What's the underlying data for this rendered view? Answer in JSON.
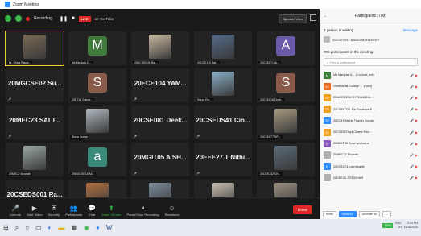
{
  "window": {
    "title": "Zoom Meeting"
  },
  "topbar": {
    "recording": "Recording...",
    "live_badge": "LIVE",
    "stream_target": "on YouTube",
    "speaker_view": "Speaker View"
  },
  "tiles": [
    {
      "kind": "photo",
      "label": "Dr. Shiva Rama...",
      "color": "#7a6a55",
      "active": true
    },
    {
      "kind": "initial",
      "initial": "M",
      "color": "#3f7b3a",
      "label": "Ms Manjula G..."
    },
    {
      "kind": "photo",
      "label": "20ECSED41 Raj...",
      "color": "#c9b9a0"
    },
    {
      "kind": "photo",
      "label": "20CSE119 Sat...",
      "color": "#556b8a"
    },
    {
      "kind": "initial",
      "initial": "A",
      "color": "#6b5aa8",
      "label": "20CSE071 Ar..."
    },
    {
      "kind": "name",
      "name": "20MGCSE02  Su...",
      "label": ""
    },
    {
      "kind": "initial",
      "initial": "S",
      "color": "#8a5a4a",
      "label": "20ET13 Sakrat..."
    },
    {
      "kind": "name",
      "name": "20ECE104  YAM...",
      "label": ""
    },
    {
      "kind": "photo",
      "label": "Surya Ra...",
      "color": "#8ab0c8"
    },
    {
      "kind": "initial",
      "initial": "S",
      "color": "#8a5a4a",
      "label": "20CSE016 Chall..."
    },
    {
      "kind": "name",
      "name": "20MEC23  SAI T...",
      "label": ""
    },
    {
      "kind": "photo",
      "label": "Shiva Kumar",
      "color": "#b0b8c0"
    },
    {
      "kind": "name",
      "name": "20CSE081  Deek...",
      "label": ""
    },
    {
      "kind": "name",
      "name": "20CSEDS41  Cin...",
      "label": ""
    },
    {
      "kind": "photo",
      "label": "20CSE077 SR...",
      "color": "#a89a80"
    },
    {
      "kind": "photo",
      "label": "20MEC2 Bharath",
      "color": "#9aa8a0"
    },
    {
      "kind": "initial",
      "initial": "a",
      "color": "#3a8a7a",
      "label": "20MGCSE18 Ak..."
    },
    {
      "kind": "name",
      "name": "20MGIT05  A SH...",
      "label": ""
    },
    {
      "kind": "name",
      "name": "20EEE27  T Nithi...",
      "label": ""
    },
    {
      "kind": "photo",
      "label": "20CSE232 Gh...",
      "color": "#5a6a78"
    },
    {
      "kind": "name",
      "name": "20CSEDS001  Ra...",
      "label": ""
    },
    {
      "kind": "photo",
      "label": "20ECE05 Ananda",
      "color": "#b07040"
    },
    {
      "kind": "photo",
      "label": "Shivakp",
      "color": "#7a8a9a"
    },
    {
      "kind": "photo",
      "label": "20CSE7029 (2)...",
      "color": "#c8c0b0"
    },
    {
      "kind": "photo",
      "label": "20ECE254Luke...",
      "color": "#9a9080"
    }
  ],
  "toolbar": {
    "items": [
      {
        "icon": "mic-icon",
        "glyph": "🎤",
        "label": "Unmute"
      },
      {
        "icon": "video-icon",
        "glyph": "▶",
        "label": "Start Video"
      },
      {
        "icon": "shield-icon",
        "glyph": "⛨",
        "label": "Security"
      },
      {
        "icon": "people-icon",
        "glyph": "👥",
        "label": "Participants"
      },
      {
        "icon": "chat-icon",
        "glyph": "💬",
        "label": "Chat"
      },
      {
        "icon": "share-icon",
        "glyph": "⬆",
        "label": "Share Screen"
      },
      {
        "icon": "pause-icon",
        "glyph": "⏸",
        "label": "Pause/Stop Recording"
      },
      {
        "icon": "smile-icon",
        "glyph": "☺",
        "label": "Reactions"
      }
    ],
    "participants_count": "709",
    "leave": "Leave"
  },
  "panel": {
    "title": "Participants (709)",
    "waiting_text": "1 person is waiting",
    "message_btn": "Message",
    "waiting_name": "20CSE0937 BANDI MAHADEEP",
    "in_meeting": "709 participants in the meeting",
    "find_placeholder": "Find a participant",
    "participants": [
      {
        "initial": "M",
        "color": "#3f7b3a",
        "name": "Ms Manjula G... (Co-host, me)"
      },
      {
        "initial": "GC",
        "color": "#e86a1e",
        "name": "Geetharjali College ... (Host)"
      },
      {
        "initial": "20",
        "color": "#f0a020",
        "name": "20MGECE06 SYED MOHA..."
      },
      {
        "initial": "20",
        "color": "#f0a020",
        "name": "20CSEOT21 Sai Goutham E..."
      },
      {
        "initial": "20",
        "color": "#2d8cff",
        "name": "20EC19 Neela Tharun Kumar"
      },
      {
        "initial": "20",
        "color": "#f0a020",
        "name": "20CSE57Gopi Chand Red..."
      },
      {
        "initial": "K",
        "color": "#8a5ab8",
        "name": "20MGIT30 Sowmya kavuri"
      },
      {
        "initial": "",
        "color": "#b0b0b0",
        "name": "20MEC22 Bharath"
      },
      {
        "initial": "K",
        "color": "#2d8cff",
        "name": "20ECE274 Laxmikanth"
      },
      {
        "initial": "",
        "color": "#b0b0b0",
        "name": "20EEE26 J SRIDHAR"
      }
    ],
    "footer": {
      "invite": "Invite",
      "mute_all": "Mute All",
      "unmute_all": "Unmute All",
      "more": "..."
    }
  },
  "taskbar": {
    "battery": "100%",
    "lang": "ENG",
    "region": "IN",
    "time": "2:44 PM",
    "date": "11/28/2020"
  }
}
